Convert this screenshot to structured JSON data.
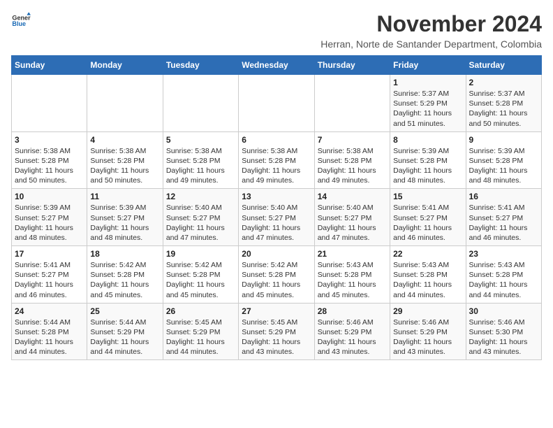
{
  "logo": {
    "general": "General",
    "blue": "Blue"
  },
  "title": "November 2024",
  "subtitle": "Herran, Norte de Santander Department, Colombia",
  "weekdays": [
    "Sunday",
    "Monday",
    "Tuesday",
    "Wednesday",
    "Thursday",
    "Friday",
    "Saturday"
  ],
  "weeks": [
    [
      {
        "day": "",
        "info": ""
      },
      {
        "day": "",
        "info": ""
      },
      {
        "day": "",
        "info": ""
      },
      {
        "day": "",
        "info": ""
      },
      {
        "day": "",
        "info": ""
      },
      {
        "day": "1",
        "info": "Sunrise: 5:37 AM\nSunset: 5:29 PM\nDaylight: 11 hours and 51 minutes."
      },
      {
        "day": "2",
        "info": "Sunrise: 5:37 AM\nSunset: 5:28 PM\nDaylight: 11 hours and 50 minutes."
      }
    ],
    [
      {
        "day": "3",
        "info": "Sunrise: 5:38 AM\nSunset: 5:28 PM\nDaylight: 11 hours and 50 minutes."
      },
      {
        "day": "4",
        "info": "Sunrise: 5:38 AM\nSunset: 5:28 PM\nDaylight: 11 hours and 50 minutes."
      },
      {
        "day": "5",
        "info": "Sunrise: 5:38 AM\nSunset: 5:28 PM\nDaylight: 11 hours and 49 minutes."
      },
      {
        "day": "6",
        "info": "Sunrise: 5:38 AM\nSunset: 5:28 PM\nDaylight: 11 hours and 49 minutes."
      },
      {
        "day": "7",
        "info": "Sunrise: 5:38 AM\nSunset: 5:28 PM\nDaylight: 11 hours and 49 minutes."
      },
      {
        "day": "8",
        "info": "Sunrise: 5:39 AM\nSunset: 5:28 PM\nDaylight: 11 hours and 48 minutes."
      },
      {
        "day": "9",
        "info": "Sunrise: 5:39 AM\nSunset: 5:28 PM\nDaylight: 11 hours and 48 minutes."
      }
    ],
    [
      {
        "day": "10",
        "info": "Sunrise: 5:39 AM\nSunset: 5:27 PM\nDaylight: 11 hours and 48 minutes."
      },
      {
        "day": "11",
        "info": "Sunrise: 5:39 AM\nSunset: 5:27 PM\nDaylight: 11 hours and 48 minutes."
      },
      {
        "day": "12",
        "info": "Sunrise: 5:40 AM\nSunset: 5:27 PM\nDaylight: 11 hours and 47 minutes."
      },
      {
        "day": "13",
        "info": "Sunrise: 5:40 AM\nSunset: 5:27 PM\nDaylight: 11 hours and 47 minutes."
      },
      {
        "day": "14",
        "info": "Sunrise: 5:40 AM\nSunset: 5:27 PM\nDaylight: 11 hours and 47 minutes."
      },
      {
        "day": "15",
        "info": "Sunrise: 5:41 AM\nSunset: 5:27 PM\nDaylight: 11 hours and 46 minutes."
      },
      {
        "day": "16",
        "info": "Sunrise: 5:41 AM\nSunset: 5:27 PM\nDaylight: 11 hours and 46 minutes."
      }
    ],
    [
      {
        "day": "17",
        "info": "Sunrise: 5:41 AM\nSunset: 5:27 PM\nDaylight: 11 hours and 46 minutes."
      },
      {
        "day": "18",
        "info": "Sunrise: 5:42 AM\nSunset: 5:28 PM\nDaylight: 11 hours and 45 minutes."
      },
      {
        "day": "19",
        "info": "Sunrise: 5:42 AM\nSunset: 5:28 PM\nDaylight: 11 hours and 45 minutes."
      },
      {
        "day": "20",
        "info": "Sunrise: 5:42 AM\nSunset: 5:28 PM\nDaylight: 11 hours and 45 minutes."
      },
      {
        "day": "21",
        "info": "Sunrise: 5:43 AM\nSunset: 5:28 PM\nDaylight: 11 hours and 45 minutes."
      },
      {
        "day": "22",
        "info": "Sunrise: 5:43 AM\nSunset: 5:28 PM\nDaylight: 11 hours and 44 minutes."
      },
      {
        "day": "23",
        "info": "Sunrise: 5:43 AM\nSunset: 5:28 PM\nDaylight: 11 hours and 44 minutes."
      }
    ],
    [
      {
        "day": "24",
        "info": "Sunrise: 5:44 AM\nSunset: 5:28 PM\nDaylight: 11 hours and 44 minutes."
      },
      {
        "day": "25",
        "info": "Sunrise: 5:44 AM\nSunset: 5:29 PM\nDaylight: 11 hours and 44 minutes."
      },
      {
        "day": "26",
        "info": "Sunrise: 5:45 AM\nSunset: 5:29 PM\nDaylight: 11 hours and 44 minutes."
      },
      {
        "day": "27",
        "info": "Sunrise: 5:45 AM\nSunset: 5:29 PM\nDaylight: 11 hours and 43 minutes."
      },
      {
        "day": "28",
        "info": "Sunrise: 5:46 AM\nSunset: 5:29 PM\nDaylight: 11 hours and 43 minutes."
      },
      {
        "day": "29",
        "info": "Sunrise: 5:46 AM\nSunset: 5:29 PM\nDaylight: 11 hours and 43 minutes."
      },
      {
        "day": "30",
        "info": "Sunrise: 5:46 AM\nSunset: 5:30 PM\nDaylight: 11 hours and 43 minutes."
      }
    ]
  ]
}
